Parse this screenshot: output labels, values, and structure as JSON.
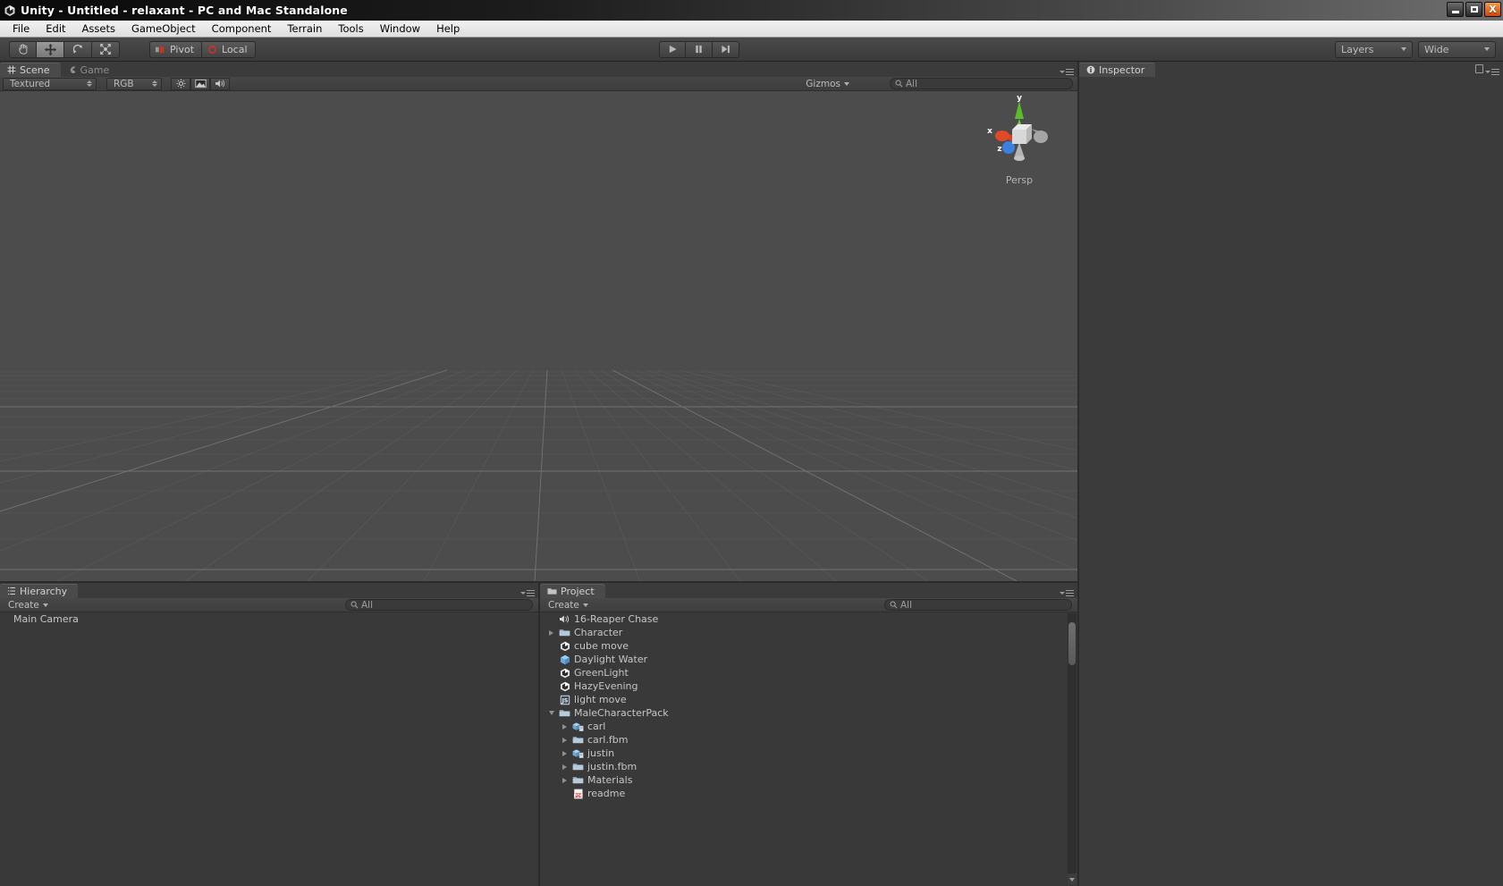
{
  "window": {
    "title": "Unity - Untitled - relaxant - PC and Mac Standalone",
    "icon": "unity-logo-icon",
    "minimize_label": "Minimize",
    "maximize_label": "Maximize",
    "close_label": "X"
  },
  "menubar": {
    "items": [
      {
        "label": "File",
        "accel": "F"
      },
      {
        "label": "Edit",
        "accel": "E"
      },
      {
        "label": "Assets",
        "accel": "A"
      },
      {
        "label": "GameObject",
        "accel": "G"
      },
      {
        "label": "Component",
        "accel": "C"
      },
      {
        "label": "Terrain",
        "accel": "T"
      },
      {
        "label": "Tools",
        "accel": "o"
      },
      {
        "label": "Window",
        "accel": "W"
      },
      {
        "label": "Help",
        "accel": "H"
      }
    ]
  },
  "toolbar": {
    "transform_tools": [
      {
        "name": "hand-tool",
        "active": false
      },
      {
        "name": "move-tool",
        "active": true
      },
      {
        "name": "rotate-tool",
        "active": false
      },
      {
        "name": "scale-tool",
        "active": false
      }
    ],
    "pivot_label": "Pivot",
    "local_label": "Local",
    "play_label": "Play",
    "pause_label": "Pause",
    "step_label": "Step",
    "layers_label": "Layers",
    "layout_label": "Wide"
  },
  "scene": {
    "tabs": [
      {
        "label": "Scene",
        "active": true,
        "icon": "grid-icon"
      },
      {
        "label": "Game",
        "active": false,
        "icon": "gamepad-icon"
      }
    ],
    "draw_mode": "Textured",
    "color_mode": "RGB",
    "toggles": [
      {
        "name": "lighting-toggle",
        "icon": "sun-icon"
      },
      {
        "name": "fx-toggle",
        "icon": "image-icon"
      },
      {
        "name": "audio-toggle",
        "icon": "speaker-icon"
      }
    ],
    "gizmos_label": "Gizmos",
    "search_placeholder": "All",
    "view_gizmo": {
      "label": "Persp",
      "axis_x": "x",
      "axis_y": "y",
      "axis_z": "z",
      "color_x": "#d94123",
      "color_y": "#5bbd2a",
      "color_z": "#3b7fe0"
    }
  },
  "hierarchy": {
    "tab_label": "Hierarchy",
    "create_label": "Create",
    "search_placeholder": "All",
    "items": [
      {
        "label": "Main Camera"
      }
    ]
  },
  "project": {
    "tab_label": "Project",
    "create_label": "Create",
    "search_placeholder": "All",
    "items": [
      {
        "label": "16-Reaper Chase",
        "icon": "audio-icon",
        "indent": 0,
        "arrow": "none"
      },
      {
        "label": "Character",
        "icon": "folder-icon",
        "indent": 0,
        "arrow": "right"
      },
      {
        "label": "cube move",
        "icon": "unity-script-icon",
        "indent": 0,
        "arrow": "none"
      },
      {
        "label": "Daylight Water",
        "icon": "prefab-icon",
        "indent": 0,
        "arrow": "none"
      },
      {
        "label": "GreenLight",
        "icon": "unity-script-icon",
        "indent": 0,
        "arrow": "none"
      },
      {
        "label": "HazyEvening",
        "icon": "unity-script-icon",
        "indent": 0,
        "arrow": "none"
      },
      {
        "label": "light move",
        "icon": "js-script-icon",
        "indent": 0,
        "arrow": "none"
      },
      {
        "label": "MaleCharacterPack",
        "icon": "folder-icon",
        "indent": 0,
        "arrow": "down"
      },
      {
        "label": "carl",
        "icon": "model-icon",
        "indent": 1,
        "arrow": "right"
      },
      {
        "label": "carl.fbm",
        "icon": "folder-icon",
        "indent": 1,
        "arrow": "right"
      },
      {
        "label": "justin",
        "icon": "model-icon",
        "indent": 1,
        "arrow": "right"
      },
      {
        "label": "justin.fbm",
        "icon": "folder-icon",
        "indent": 1,
        "arrow": "right"
      },
      {
        "label": "Materials",
        "icon": "folder-icon",
        "indent": 1,
        "arrow": "right"
      },
      {
        "label": "readme",
        "icon": "pdf-icon",
        "indent": 1,
        "arrow": "none"
      }
    ]
  },
  "inspector": {
    "tab_label": "Inspector",
    "icon": "info-icon"
  },
  "colors": {
    "scene_background": "#4c4c4c",
    "panel_background": "#3b3b3b",
    "list_background": "#393939",
    "accent_close": "#d1450a"
  }
}
